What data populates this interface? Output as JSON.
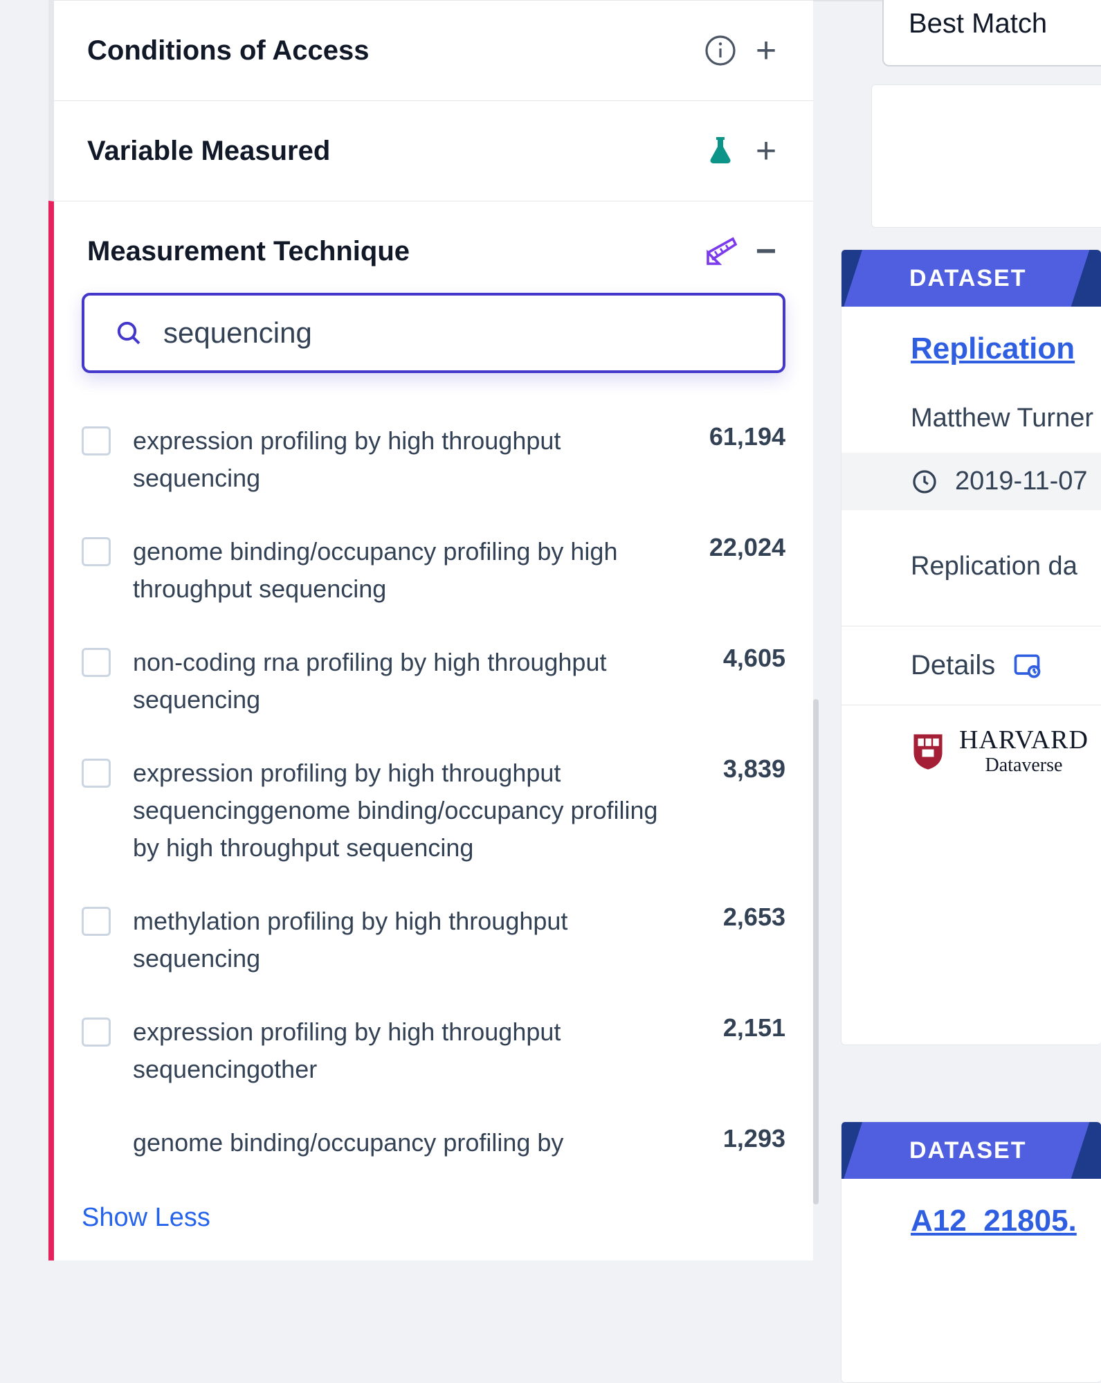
{
  "sort": {
    "label": "Best Match"
  },
  "filters": {
    "conditions": {
      "title": "Conditions of Access",
      "expanded": false,
      "icon": "info"
    },
    "variable": {
      "title": "Variable Measured",
      "expanded": false,
      "icon": "flask"
    },
    "technique": {
      "title": "Measurement Technique",
      "expanded": true,
      "icon": "ruler",
      "search_value": "sequencing",
      "search_placeholder": "",
      "show_less_label": "Show Less",
      "options": [
        {
          "label": "expression profiling by high throughput sequencing",
          "count": "61,194"
        },
        {
          "label": "genome binding/occupancy profiling by high throughput sequencing",
          "count": "22,024"
        },
        {
          "label": "non-coding rna profiling by high throughput sequencing",
          "count": "4,605"
        },
        {
          "label": "expression profiling by high throughput sequencinggenome binding/occupancy profiling by high throughput sequencing",
          "count": "3,839"
        },
        {
          "label": "methylation profiling by high throughput sequencing",
          "count": "2,653"
        },
        {
          "label": "expression profiling by high throughput sequencingother",
          "count": "2,151"
        },
        {
          "label": "genome binding/occupancy profiling by",
          "count": "1,293"
        }
      ]
    }
  },
  "results": [
    {
      "badge": "DATASET",
      "title": "Replication",
      "author": "Matthew Turner",
      "date": "2019-11-07",
      "description": "Replication da",
      "details_label": "Details",
      "provider_name": "HARVARD",
      "provider_sub": "Dataverse"
    },
    {
      "badge": "DATASET",
      "title": "A12_21805."
    }
  ]
}
